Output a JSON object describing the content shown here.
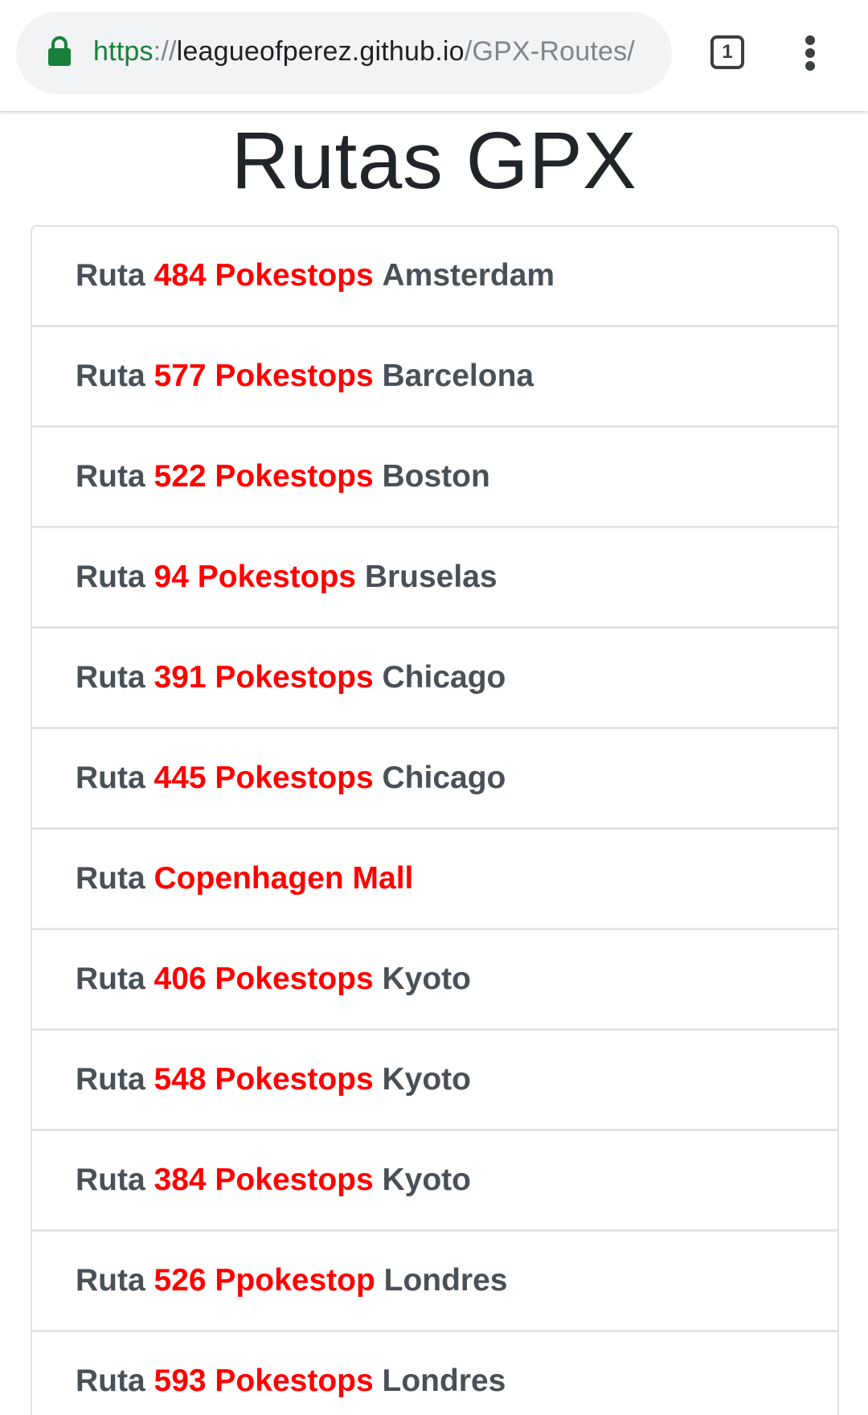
{
  "browser": {
    "url_scheme": "https",
    "url_separator": "://",
    "url_host": "leagueofperez.github.io",
    "url_path": "/GPX-Routes/",
    "tab_count": "1",
    "secure_icon": "lock-icon",
    "menu_icon": "more-vert-icon"
  },
  "page": {
    "title": "Rutas GPX"
  },
  "routes": [
    {
      "prefix": "Ruta",
      "highlight": "484 Pokestops",
      "city": "Amsterdam"
    },
    {
      "prefix": "Ruta",
      "highlight": "577 Pokestops",
      "city": "Barcelona"
    },
    {
      "prefix": "Ruta",
      "highlight": "522 Pokestops",
      "city": "Boston"
    },
    {
      "prefix": "Ruta",
      "highlight": "94 Pokestops",
      "city": "Bruselas"
    },
    {
      "prefix": "Ruta",
      "highlight": "391 Pokestops",
      "city": "Chicago"
    },
    {
      "prefix": "Ruta",
      "highlight": "445 Pokestops",
      "city": "Chicago"
    },
    {
      "prefix": "Ruta",
      "highlight": "Copenhagen Mall",
      "city": ""
    },
    {
      "prefix": "Ruta",
      "highlight": "406 Pokestops",
      "city": "Kyoto"
    },
    {
      "prefix": "Ruta",
      "highlight": "548 Pokestops",
      "city": "Kyoto"
    },
    {
      "prefix": "Ruta",
      "highlight": "384 Pokestops",
      "city": "Kyoto"
    },
    {
      "prefix": "Ruta",
      "highlight": "526 Ppokestop",
      "city": "Londres"
    },
    {
      "prefix": "Ruta",
      "highlight": "593 Pokestops",
      "city": "Londres"
    }
  ],
  "colors": {
    "highlight": "#ff0000",
    "text": "#495057",
    "title": "#212529",
    "secure": "#188038"
  }
}
